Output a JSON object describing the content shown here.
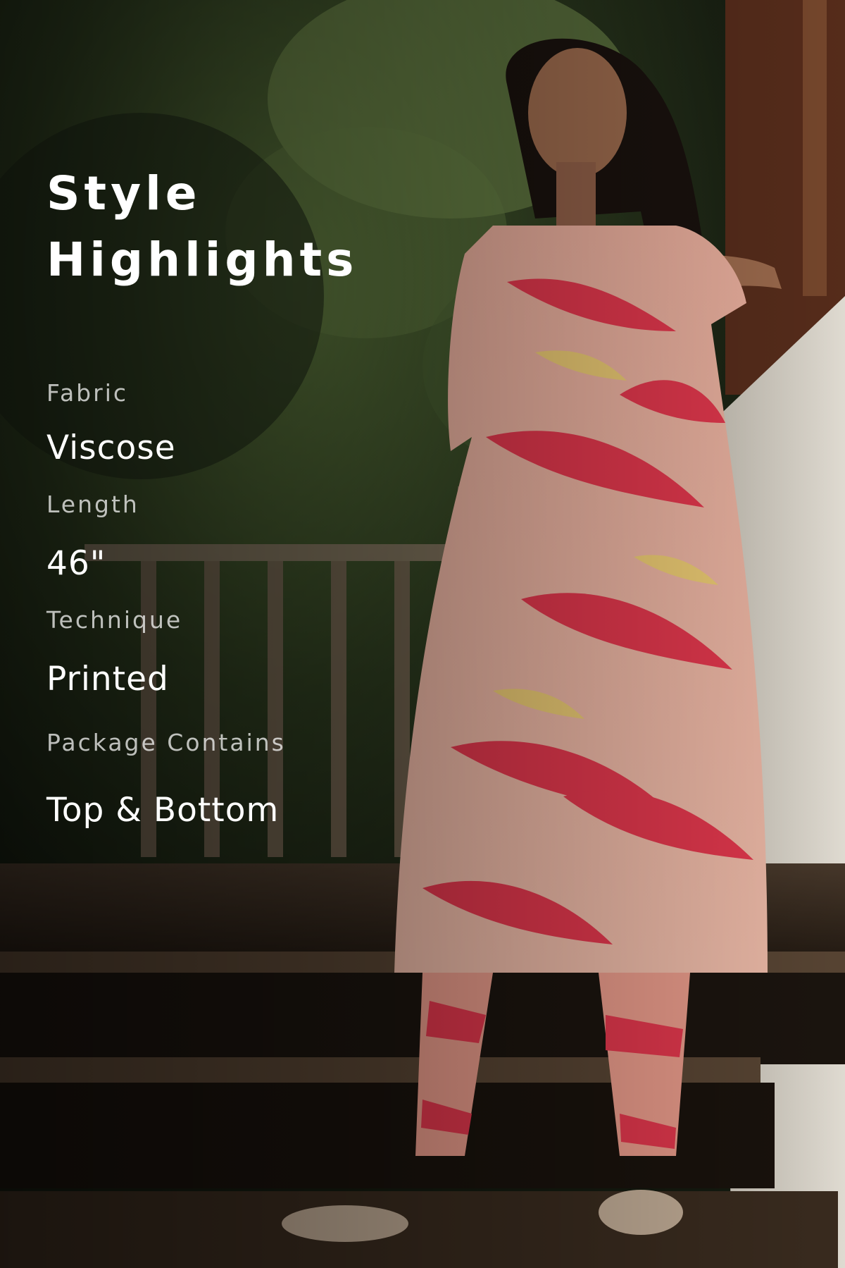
{
  "heading": {
    "line1": "Style",
    "line2": "Highlights"
  },
  "specs": [
    {
      "label": "Fabric",
      "value": "Viscose"
    },
    {
      "label": "Length",
      "value": "46\""
    },
    {
      "label": "Technique",
      "value": "Printed"
    },
    {
      "label": "Package Contains",
      "value": "Top & Bottom"
    }
  ],
  "colors": {
    "text_primary": "#ffffff",
    "text_secondary": "#d4d4d2",
    "garment_base": "#f2b9a8",
    "garment_print": "#e8394f",
    "garment_accent": "#f3d76b"
  }
}
